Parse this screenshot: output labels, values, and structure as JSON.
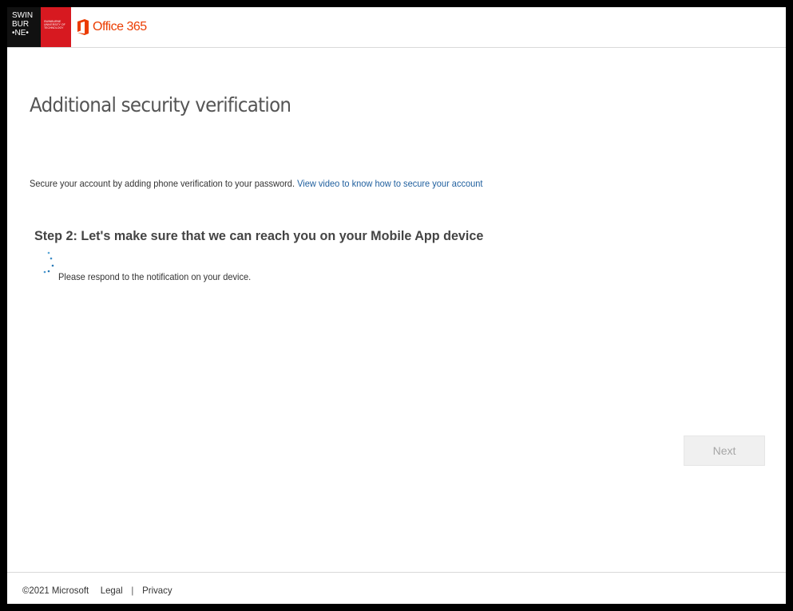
{
  "header": {
    "university_logo_text": "SWIN\nBUR\n•NE•",
    "university_sub_text": "SWINBURNE UNIVERSITY OF TECHNOLOGY",
    "product_name": "Office 365",
    "product_icon": "office-icon",
    "brand_color": "#d71920",
    "office_color": "#eb3c00"
  },
  "main": {
    "title": "Additional security verification",
    "intro_text": "Secure your account by adding phone verification to your password.",
    "intro_link": "View video to know how to secure your account",
    "step_heading": "Step 2: Let's make sure that we can reach you on your Mobile App device",
    "status_icon": "spinner-icon",
    "status_text": "Please respond to the notification on your device.",
    "next_button_label": "Next",
    "next_button_enabled": false
  },
  "footer": {
    "copyright": "©2021 Microsoft",
    "legal_link": "Legal",
    "separator": "|",
    "privacy_link": "Privacy"
  }
}
